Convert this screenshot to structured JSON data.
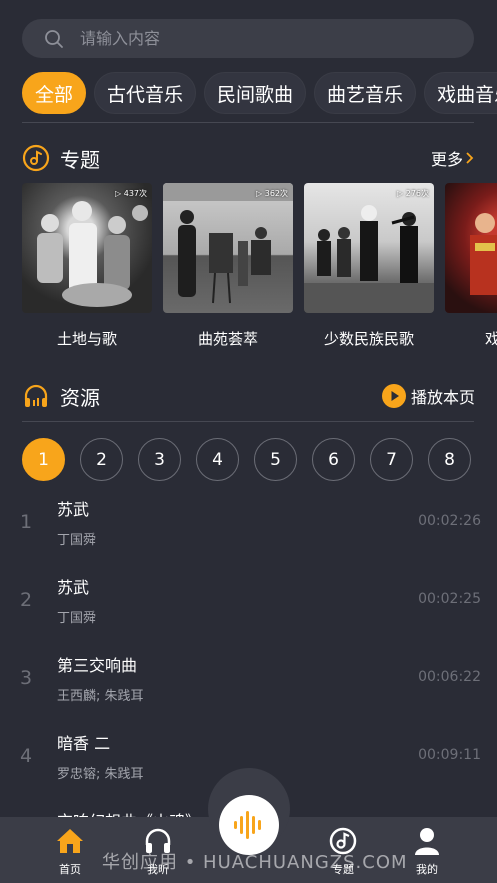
{
  "search": {
    "placeholder": "请输入内容"
  },
  "categories": [
    {
      "label": "全部",
      "active": true
    },
    {
      "label": "古代音乐"
    },
    {
      "label": "民间歌曲"
    },
    {
      "label": "曲艺音乐"
    },
    {
      "label": "戏曲音乐"
    }
  ],
  "topics_section": {
    "title": "专题",
    "more_label": "更多",
    "items": [
      {
        "name": "土地与歌",
        "count": "▷ 437次"
      },
      {
        "name": "曲苑荟萃",
        "count": "▷ 362次"
      },
      {
        "name": "少数民族民歌",
        "count": "▷ 276次"
      },
      {
        "name": "戏",
        "count": ""
      }
    ]
  },
  "resources_section": {
    "title": "资源",
    "play_page_label": "播放本页"
  },
  "pagination": [
    "1",
    "2",
    "3",
    "4",
    "5",
    "6",
    "7",
    "8"
  ],
  "tracks": [
    {
      "num": "1",
      "title": "苏武",
      "artist": "丁国舜",
      "duration": "00:02:26"
    },
    {
      "num": "2",
      "title": "苏武",
      "artist": "丁国舜",
      "duration": "00:02:25"
    },
    {
      "num": "3",
      "title": "第三交响曲",
      "artist": "王西麟; 朱践耳",
      "duration": "00:06:22"
    },
    {
      "num": "4",
      "title": "暗香 二",
      "artist": "罗忠镕; 朱践耳",
      "duration": "00:09:11"
    },
    {
      "num": "",
      "title": "交响幻想曲《山魂》",
      "artist": "",
      "duration": ""
    }
  ],
  "tabbar": {
    "home": "首页",
    "listen": "我听",
    "topics": "专题",
    "mine": "我的"
  },
  "watermark": "华创应用 • HUACHUANGZS.COM",
  "colors": {
    "accent": "#f8a51b",
    "background": "#2a2c36",
    "tabbar": "#3b3d47"
  }
}
